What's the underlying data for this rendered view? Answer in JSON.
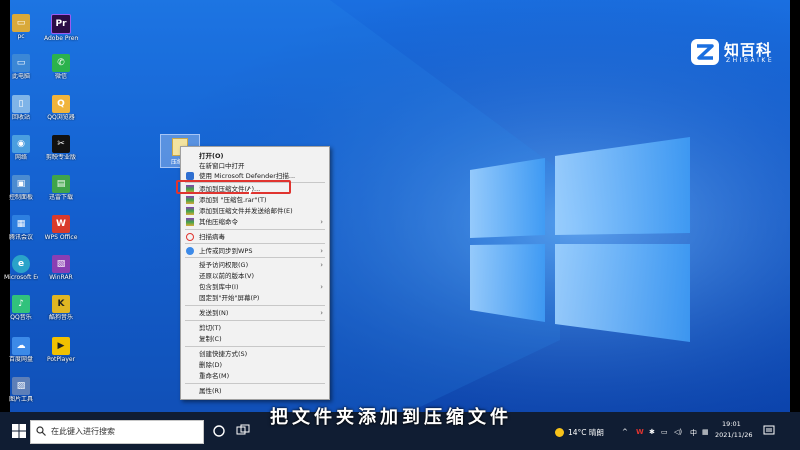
{
  "desktop": {
    "icons": [
      {
        "label": "pc",
        "glyph": "▭",
        "color": "#d9a93a"
      },
      {
        "label": "Adobe Premiere...",
        "glyph": "Pr",
        "color": "#2a0d45"
      },
      {
        "label": "此电脑",
        "glyph": "▭",
        "color": "#3b87d6"
      },
      {
        "label": "微信",
        "glyph": "✆",
        "color": "#2bb24c"
      },
      {
        "label": "回收站",
        "glyph": "▯",
        "color": "#7fb4e8"
      },
      {
        "label": "QQ浏览器",
        "glyph": "Q",
        "color": "#f0b43c"
      },
      {
        "label": "网络",
        "glyph": "◉",
        "color": "#4a9ee0"
      },
      {
        "label": "剪映专业版",
        "glyph": "✂",
        "color": "#111111"
      },
      {
        "label": "控制面板",
        "glyph": "▣",
        "color": "#4b8bd1"
      },
      {
        "label": "迅雷下载",
        "glyph": "▤",
        "color": "#3fa44a"
      },
      {
        "label": "腾讯会议",
        "glyph": "▦",
        "color": "#2d7fe0"
      },
      {
        "label": "WPS Office",
        "glyph": "W",
        "color": "#d93a2b"
      },
      {
        "label": "Microsoft Edge",
        "glyph": "e",
        "color": "#2aa3c9"
      },
      {
        "label": "WinRAR",
        "glyph": "▧",
        "color": "#8a3fb3"
      },
      {
        "label": "QQ音乐",
        "glyph": "♪",
        "color": "#31c27c"
      },
      {
        "label": "酷狗音乐",
        "glyph": "K",
        "color": "#e0b623"
      },
      {
        "label": "百度网盘",
        "glyph": "☁",
        "color": "#3c8ae8"
      },
      {
        "label": "PotPlayer",
        "glyph": "▶",
        "color": "#f2c100"
      },
      {
        "label": "图片工具",
        "glyph": "▨",
        "color": "#5d7fb8"
      }
    ],
    "selected_file_label": "压缩包"
  },
  "context_menu": {
    "items": [
      {
        "label": "打开(O)",
        "bold": true
      },
      {
        "label": "在新窗口中打开"
      },
      {
        "label": "使用 Microsoft Defender扫描...",
        "icon": "defender"
      },
      {
        "label": "添加到压缩文件(A)...",
        "icon": "winrar",
        "highlighted": true
      },
      {
        "label": "添加到 \"压缩包.rar\"(T)",
        "icon": "winrar"
      },
      {
        "label": "添加到压缩文件并发送给邮件(E)",
        "icon": "winrar"
      },
      {
        "label": "其他压缩命令",
        "icon": "winrar",
        "submenu": true
      },
      {
        "label": "扫描病毒",
        "icon": "scan"
      },
      {
        "label": "上传或同步到WPS",
        "icon": "wps",
        "submenu": true
      },
      {
        "label": "授予访问权限(G)",
        "submenu": true
      },
      {
        "label": "还原以前的版本(V)"
      },
      {
        "label": "包含到库中(I)",
        "submenu": true
      },
      {
        "label": "固定到\"开始\"屏幕(P)"
      },
      {
        "label": "发送到(N)",
        "submenu": true
      },
      {
        "label": "剪切(T)"
      },
      {
        "label": "复制(C)"
      },
      {
        "label": "创建快捷方式(S)"
      },
      {
        "label": "删除(D)"
      },
      {
        "label": "重命名(M)"
      },
      {
        "label": "属性(R)"
      }
    ]
  },
  "watermark": {
    "name": "知百科",
    "sub": "ZHIBAIKE"
  },
  "subtitle": "把文件夹添加到压缩文件",
  "taskbar": {
    "search_placeholder": "在此键入进行搜索",
    "weather": "14°C 晴朗",
    "time": "19:01",
    "date": "2021/11/26"
  },
  "colors": {
    "highlight": "#e0342f",
    "taskbar": "#101d33",
    "desktop": "#0f56c9"
  }
}
